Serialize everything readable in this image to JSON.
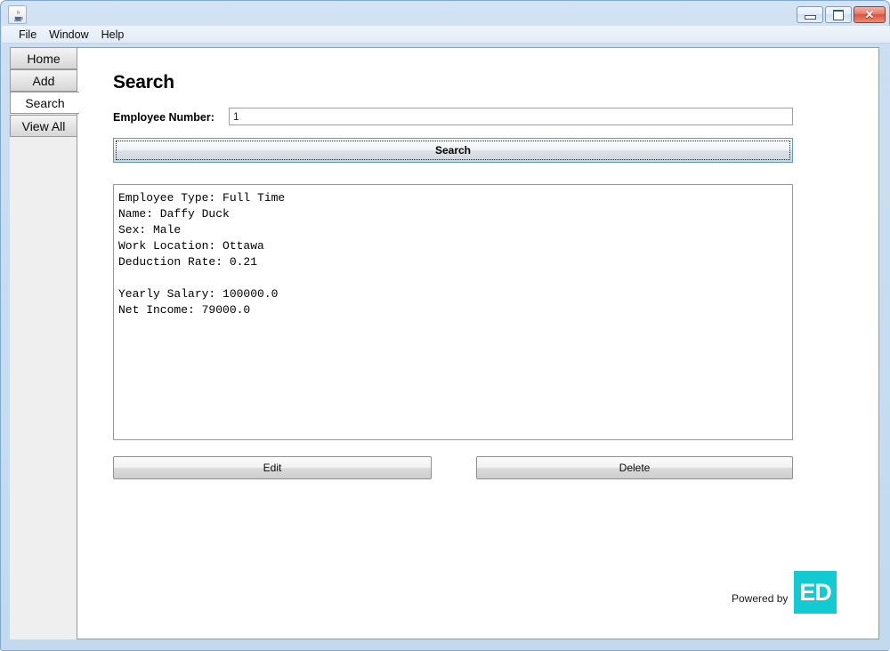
{
  "window": {
    "title": "",
    "app_icon": "java-coffee-cup-icon",
    "controls": {
      "minimize": "minimize-icon",
      "maximize": "maximize-icon",
      "close": "✕"
    }
  },
  "menubar": {
    "items": [
      {
        "label": "File"
      },
      {
        "label": "Window"
      },
      {
        "label": "Help"
      }
    ]
  },
  "tabs": [
    {
      "label": "Home",
      "active": false
    },
    {
      "label": "Add",
      "active": false
    },
    {
      "label": "Search",
      "active": true
    },
    {
      "label": "View All",
      "active": false
    }
  ],
  "main": {
    "title": "Search",
    "employee_number": {
      "label": "Employee Number:",
      "value": "1",
      "placeholder": ""
    },
    "search_button": "Search",
    "result_text": "Employee Type: Full Time\nName: Daffy Duck\nSex: Male\nWork Location: Ottawa\nDeduction Rate: 0.21\n\nYearly Salary: 100000.0\nNet Income: 79000.0",
    "edit_button": "Edit",
    "delete_button": "Delete"
  },
  "footer": {
    "powered_by": "Powered by",
    "logo_text": "ED",
    "logo_color": "#11cad2"
  }
}
